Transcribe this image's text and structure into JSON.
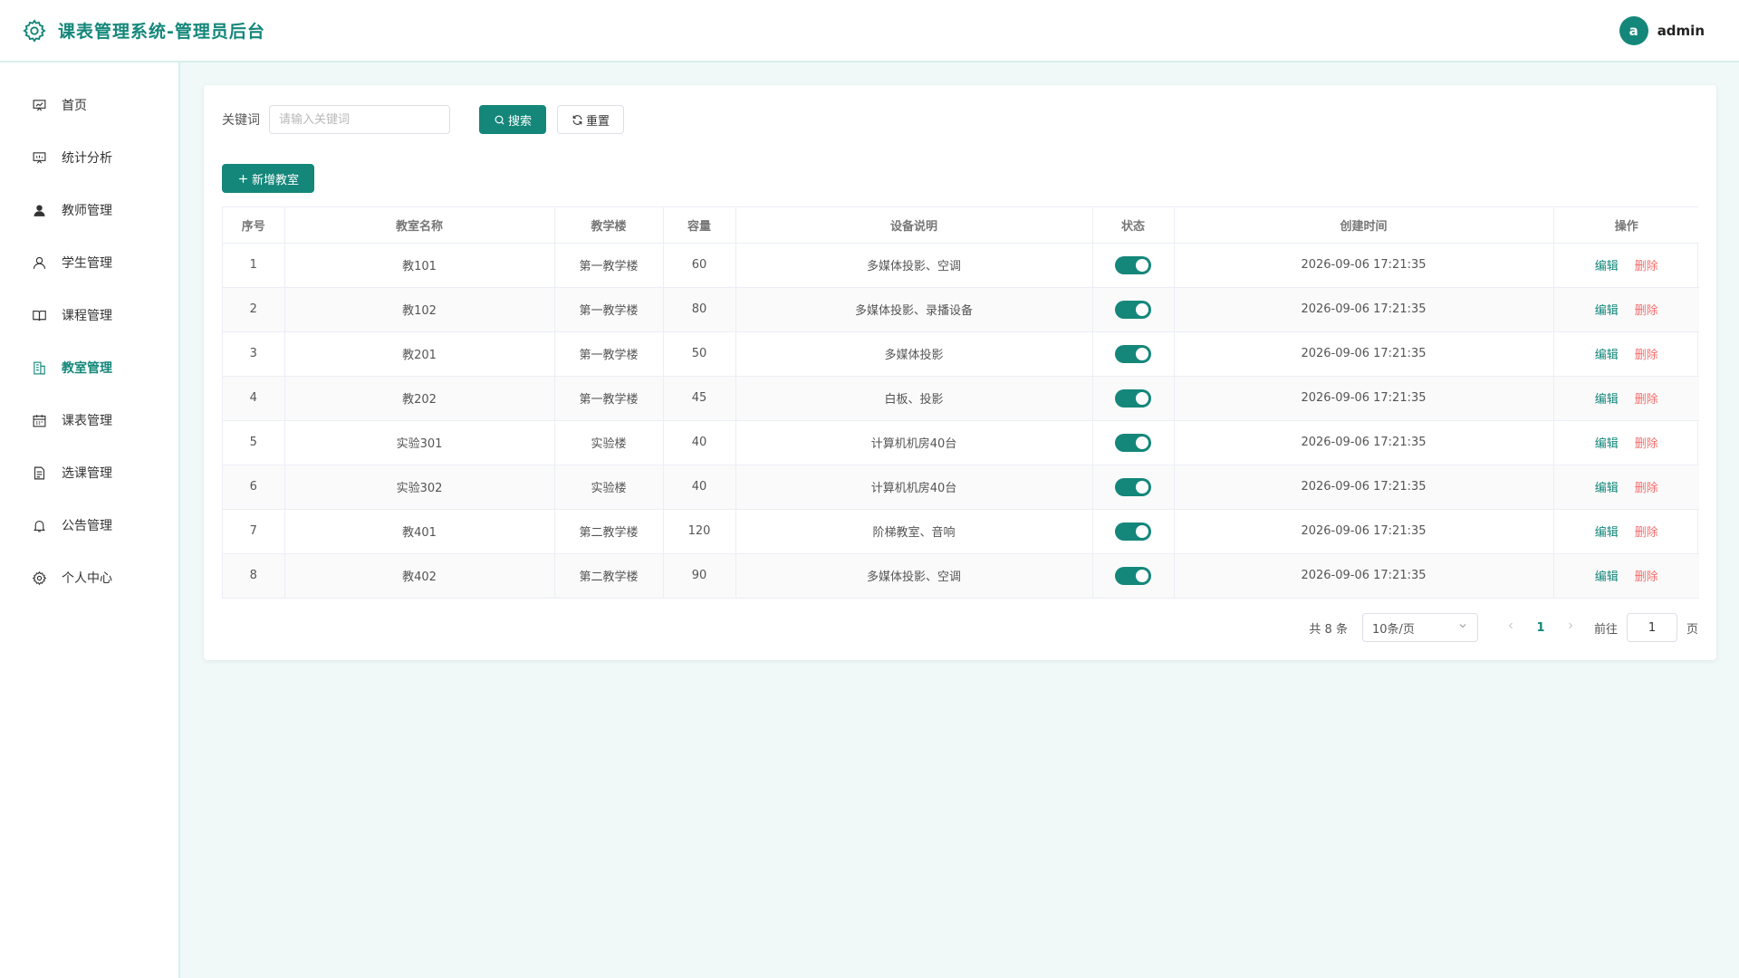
{
  "header": {
    "title": "课表管理系统-管理员后台",
    "logo_icon": "gear-icon",
    "user": {
      "avatar_letter": "a",
      "name": "admin"
    }
  },
  "colors": {
    "accent": "#14877a",
    "danger": "#f56c6c"
  },
  "sidebar": {
    "items": [
      {
        "label": "首页",
        "icon": "presentation-icon",
        "active": false
      },
      {
        "label": "统计分析",
        "icon": "chart-board-icon",
        "active": false
      },
      {
        "label": "教师管理",
        "icon": "user-filled-icon",
        "active": false
      },
      {
        "label": "学生管理",
        "icon": "user-icon",
        "active": false
      },
      {
        "label": "课程管理",
        "icon": "book-icon",
        "active": false
      },
      {
        "label": "教室管理",
        "icon": "building-icon",
        "active": true
      },
      {
        "label": "课表管理",
        "icon": "calendar-icon",
        "active": false
      },
      {
        "label": "选课管理",
        "icon": "document-icon",
        "active": false
      },
      {
        "label": "公告管理",
        "icon": "bell-icon",
        "active": false
      },
      {
        "label": "个人中心",
        "icon": "settings-icon",
        "active": false
      }
    ]
  },
  "search": {
    "label": "关键词",
    "placeholder": "请输入关键词",
    "value": "",
    "search_button": "搜索",
    "reset_button": "重置"
  },
  "toolbar": {
    "add_button": "新增教室"
  },
  "table": {
    "columns": [
      "序号",
      "教室名称",
      "教学楼",
      "容量",
      "设备说明",
      "状态",
      "创建时间",
      "操作"
    ],
    "edit_label": "编辑",
    "delete_label": "删除",
    "rows": [
      {
        "no": "1",
        "name": "教101",
        "building": "第一教学楼",
        "capacity": "60",
        "equipment": "多媒体投影、空调",
        "status": true,
        "created": "2026-09-06 17:21:35"
      },
      {
        "no": "2",
        "name": "教102",
        "building": "第一教学楼",
        "capacity": "80",
        "equipment": "多媒体投影、录播设备",
        "status": true,
        "created": "2026-09-06 17:21:35"
      },
      {
        "no": "3",
        "name": "教201",
        "building": "第一教学楼",
        "capacity": "50",
        "equipment": "多媒体投影",
        "status": true,
        "created": "2026-09-06 17:21:35"
      },
      {
        "no": "4",
        "name": "教202",
        "building": "第一教学楼",
        "capacity": "45",
        "equipment": "白板、投影",
        "status": true,
        "created": "2026-09-06 17:21:35"
      },
      {
        "no": "5",
        "name": "实验301",
        "building": "实验楼",
        "capacity": "40",
        "equipment": "计算机机房40台",
        "status": true,
        "created": "2026-09-06 17:21:35"
      },
      {
        "no": "6",
        "name": "实验302",
        "building": "实验楼",
        "capacity": "40",
        "equipment": "计算机机房40台",
        "status": true,
        "created": "2026-09-06 17:21:35"
      },
      {
        "no": "7",
        "name": "教401",
        "building": "第二教学楼",
        "capacity": "120",
        "equipment": "阶梯教室、音响",
        "status": true,
        "created": "2026-09-06 17:21:35"
      },
      {
        "no": "8",
        "name": "教402",
        "building": "第二教学楼",
        "capacity": "90",
        "equipment": "多媒体投影、空调",
        "status": true,
        "created": "2026-09-06 17:21:35"
      }
    ]
  },
  "pagination": {
    "total_text": "共 8 条",
    "page_size": "10条/页",
    "current_page": "1",
    "goto_label": "前往",
    "goto_value": "1",
    "page_unit": "页"
  }
}
